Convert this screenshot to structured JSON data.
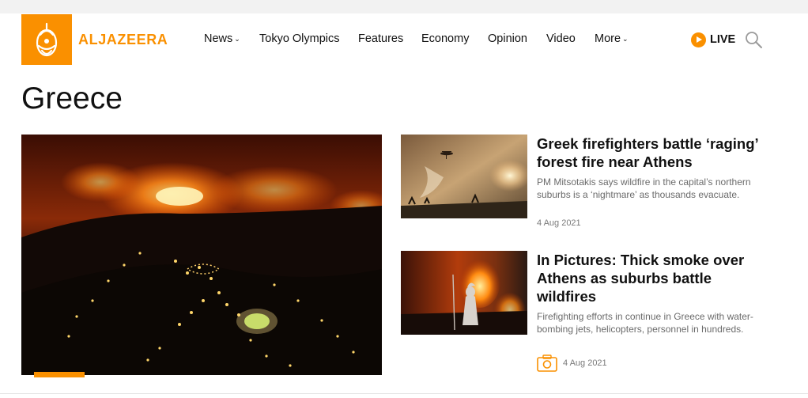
{
  "header": {
    "logo_text": "ALJAZEERA",
    "nav": [
      {
        "label": "News",
        "has_dropdown": true
      },
      {
        "label": "Tokyo Olympics",
        "has_dropdown": false
      },
      {
        "label": "Features",
        "has_dropdown": false
      },
      {
        "label": "Economy",
        "has_dropdown": false
      },
      {
        "label": "Opinion",
        "has_dropdown": false
      },
      {
        "label": "Video",
        "has_dropdown": false
      },
      {
        "label": "More",
        "has_dropdown": true
      }
    ],
    "live_label": "LIVE",
    "icons": {
      "live": "play-circle-icon",
      "search": "search-icon",
      "dropdown": "chevron-down-icon",
      "gallery": "camera-icon"
    }
  },
  "page": {
    "title": "Greece"
  },
  "articles": [
    {
      "headline": "Greek firefighters battle ‘raging’ forest fire near Athens",
      "summary": "PM Mitsotakis says wildfire in the capital’s northern suburbs is a ‘nightmare’ as thousands evacuate.",
      "date": "4 Aug 2021",
      "is_gallery": false
    },
    {
      "headline": "In Pictures: Thick smoke over Athens as suburbs battle wildfires",
      "summary": "Firefighting efforts in continue in Greece with water-bombing jets, helicopters, personnel in hundreds.",
      "date": "4 Aug 2021",
      "is_gallery": true
    }
  ],
  "colors": {
    "brand": "#fa9000",
    "text": "#111111",
    "muted": "#6b6b6b",
    "background": "#ffffff",
    "top_strip": "#f2f2f2"
  }
}
